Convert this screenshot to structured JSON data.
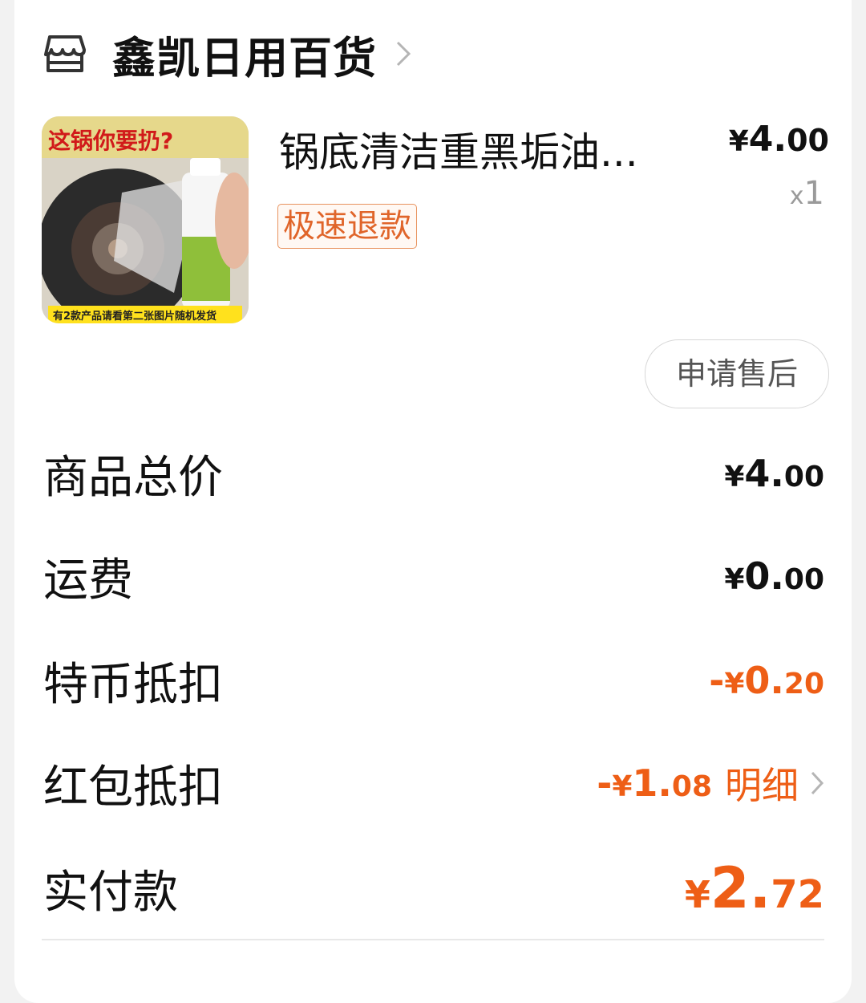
{
  "shop": {
    "icon": "store-icon",
    "name": "鑫凯日用百货"
  },
  "product": {
    "title": "锅底清洁重黑垢油...",
    "image_text_top": "这锅你要扔?",
    "image_text_bottom": "有2款产品请看第二张图片随机发货",
    "refund_tag": "极速退款",
    "price_symbol": "¥",
    "price_int": "4.",
    "price_dec": "00",
    "qty_prefix": "x",
    "qty": "1",
    "after_sale_button": "申请售后"
  },
  "summary": [
    {
      "label": "商品总价",
      "prefix": "",
      "symbol": "¥",
      "int": "4.",
      "dec": "00"
    },
    {
      "label": "运费",
      "prefix": "",
      "symbol": "¥",
      "int": "0.",
      "dec": "00"
    },
    {
      "label": "特币抵扣",
      "prefix": "-",
      "symbol": "¥",
      "int": "0.",
      "dec": "20"
    },
    {
      "label": "红包抵扣",
      "prefix": "-",
      "symbol": "¥",
      "int": "1.",
      "dec": "08",
      "link": "明细"
    },
    {
      "label": "实付款",
      "prefix": "",
      "symbol": "¥",
      "int": "2.",
      "dec": "72"
    }
  ],
  "colors": {
    "accent": "#ee5e16",
    "text": "#111111",
    "muted": "#9a9a9a"
  }
}
